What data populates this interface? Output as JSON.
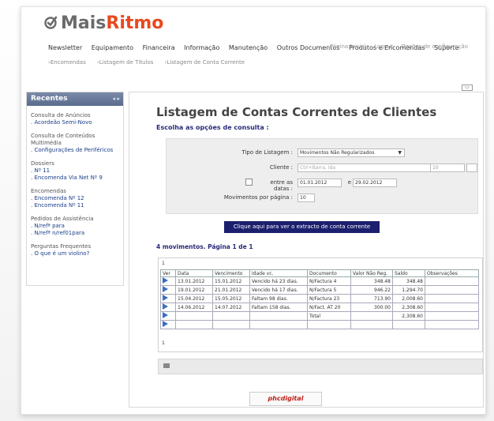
{
  "app": {
    "logo_mais": "Mais",
    "logo_ritmo": "Ritmo",
    "brand_color": "#e8491f"
  },
  "nav": {
    "items": [
      "Newsletter",
      "Equipamento",
      "Financeira",
      "Informação",
      "Manutenção",
      "Outros Documentos",
      "Produtos e Encomendas",
      "Suporte"
    ],
    "top_links": [
      "Página Inicial",
      "Logout",
      "Opções de configuração"
    ]
  },
  "breadcrumb": [
    "Encomendas",
    "Listagem de Títulos",
    "Listagem de Conta Corrente"
  ],
  "sidebar": {
    "title": "Recentes",
    "sections": [
      {
        "category": "Consulta de Anúncios",
        "items": [
          ". Acordeão Semi-Novo"
        ]
      },
      {
        "category": "Consulta de Conteúdos Multimédia",
        "items": [
          ". Configurações de Periféricos"
        ]
      },
      {
        "category": "Dossiers",
        "items": [
          ". Nº 11",
          ". Encomenda Via Net Nº 9"
        ]
      },
      {
        "category": "Encomendas",
        "items": [
          ". Encomenda Nº 12",
          ". Encomenda Nº 11"
        ]
      },
      {
        "category": "Pedidos de Assistência",
        "items": [
          ". N/refª para",
          ". N/refª n/ref01para"
        ]
      },
      {
        "category": "Perguntas Frequentes",
        "items": [
          ". O que é um violino?"
        ]
      }
    ]
  },
  "main": {
    "title": "Listagem de Contas Correntes de Clientes",
    "subtitle": "Escolha as opções de consulta :",
    "form": {
      "tipo_label": "Tipo de Listagem :",
      "tipo_value": "Movimentos Não Regularizados",
      "cliente_label": "Cliente :",
      "cliente_placeholder": "Ctrl+Barra, Ida",
      "cliente_code": "10",
      "datas_label": "entre as datas :",
      "date_from": "01.01.2012",
      "date_sep": "e",
      "date_to": "29.02.2012",
      "movs_label": "Movimentos por página :",
      "movs_value": "10"
    },
    "extract_button": "Clique aqui para ver o extracto de conta corrente",
    "count_text": "4 movimentos. Página 1 de 1",
    "page_top": "1",
    "page_bottom": "1",
    "table": {
      "headers": [
        "Ver",
        "Data",
        "Vencimento",
        "Idade vc.",
        "Documento",
        "Valor Não Reg.",
        "Saldo",
        "Observações"
      ],
      "rows": [
        [
          "13.01.2012",
          "15.01.2012",
          "Vencido há 23 dias.",
          "N/Factura 4",
          "348.48",
          "348.48",
          ""
        ],
        [
          "19.01.2012",
          "21.01.2012",
          "Vencido há 17 dias.",
          "N/Factura 5",
          "946.22",
          "1,294.70",
          ""
        ],
        [
          "15.04.2012",
          "15.05.2012",
          "Faltam 98 dias.",
          "N/Factura 23",
          "713.90",
          "2,008.60",
          ""
        ],
        [
          "14.06.2012",
          "14.07.2012",
          "Faltam 158 dias.",
          "N/Fact. AT 20",
          "300.00",
          "2,308.60",
          ""
        ],
        [
          "",
          "",
          "",
          "Total",
          "",
          "2,308.60",
          ""
        ]
      ]
    }
  },
  "footer": {
    "brand": "phcdigital"
  }
}
